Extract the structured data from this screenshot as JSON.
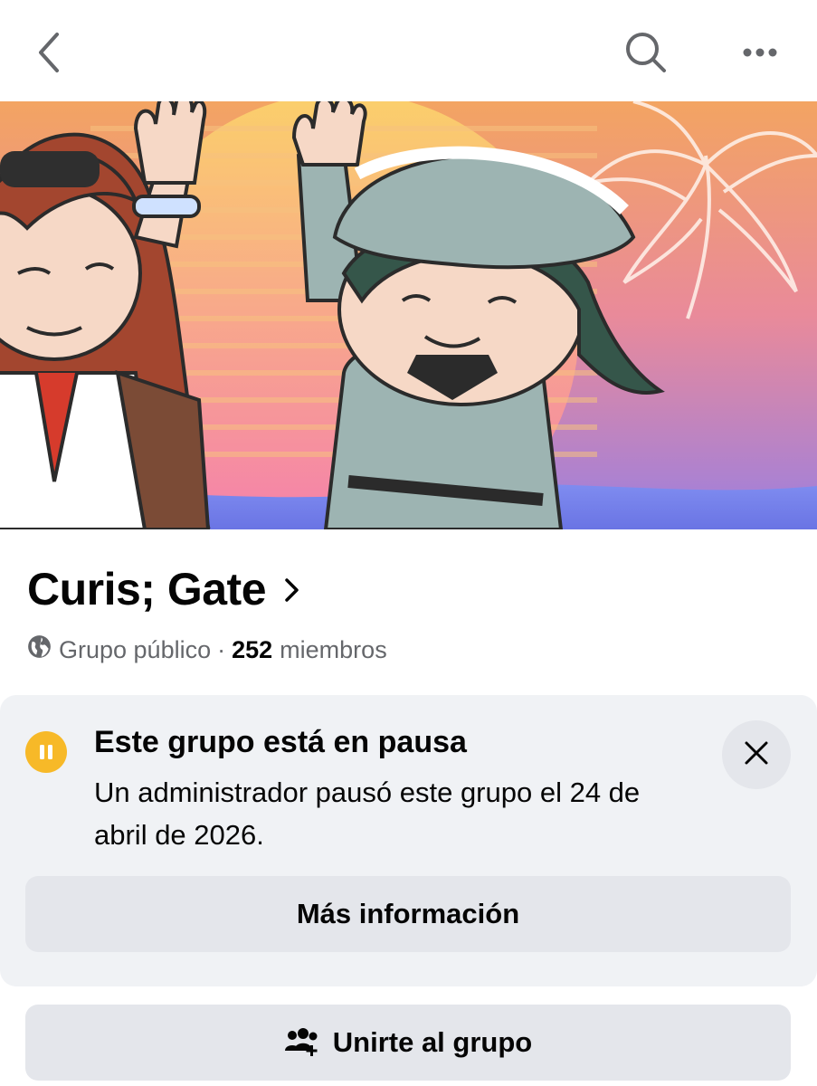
{
  "topbar": {
    "back_icon": "chevron-left-icon",
    "search_icon": "search-icon",
    "more_icon": "more-horizontal-icon"
  },
  "cover": {
    "description_icon": "group-cover-image"
  },
  "group": {
    "name": "Curis; Gate",
    "privacy_icon": "globe-icon",
    "privacy": "Grupo público",
    "separator": "·",
    "member_count": "252",
    "members_label": "miembros"
  },
  "pause_notice": {
    "icon": "pause-icon",
    "title": "Este grupo está en pausa",
    "description": "Un administrador pausó este grupo el 24 de abril de 2026.",
    "close_icon": "close-icon",
    "more_info_label": "Más información"
  },
  "join": {
    "icon": "add-people-icon",
    "label": "Unirte al grupo"
  },
  "colors": {
    "pause_accent": "#f7b928",
    "button_bg": "#e4e6eb",
    "card_bg": "#f0f2f5",
    "secondary_text": "#65676b"
  }
}
